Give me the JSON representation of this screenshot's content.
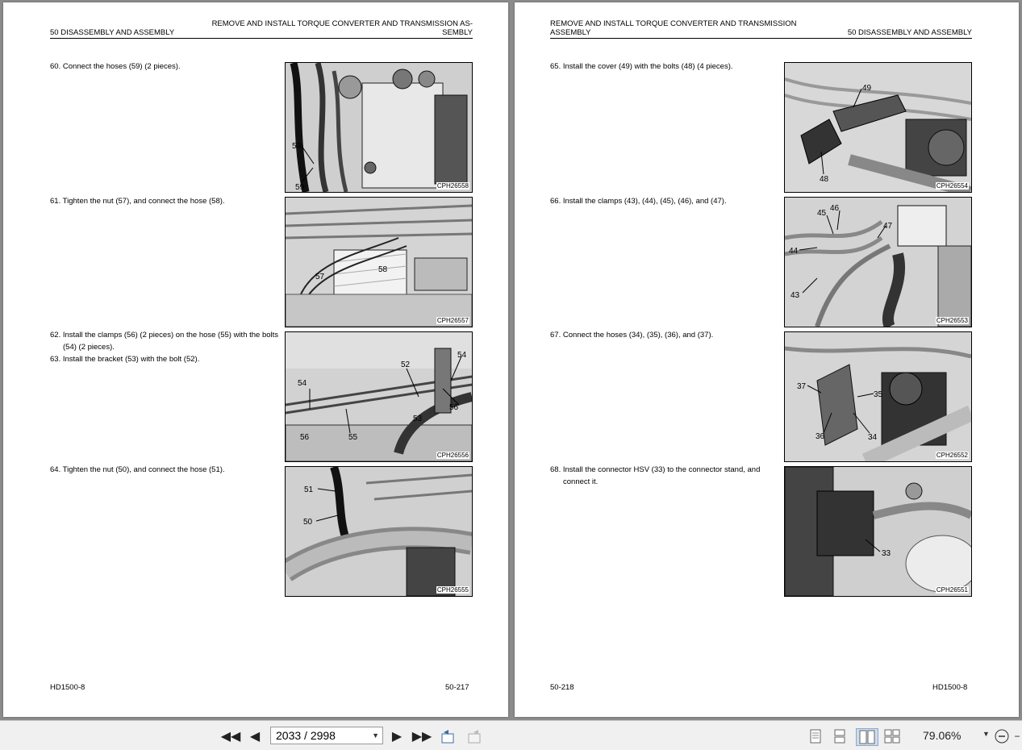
{
  "left_page": {
    "header_left": "50 DISASSEMBLY AND ASSEMBLY",
    "header_right": "REMOVE AND INSTALL TORQUE CONVERTER AND TRANSMISSION AS-SEMBLY",
    "steps": [
      {
        "text": "60. Connect the hoses (59) (2 pieces)."
      },
      {
        "text": "61. Tighten the nut (57), and connect the hose (58)."
      },
      {
        "text": "62. Install the clamps (56) (2 pieces) on the hose (55) with the bolts (54) (2 pieces).",
        "text2": "63. Install the bracket (53) with the bolt (52)."
      },
      {
        "text": "64. Tighten the nut (50), and connect the hose (51)."
      }
    ],
    "figures": [
      {
        "code": "CPH26558",
        "labels": [
          "59",
          "59"
        ]
      },
      {
        "code": "CPH26557",
        "labels": [
          "58",
          "57"
        ]
      },
      {
        "code": "CPH26556",
        "labels": [
          "52",
          "54",
          "54",
          "56",
          "53",
          "56",
          "55"
        ]
      },
      {
        "code": "CPH26555",
        "labels": [
          "51",
          "50"
        ]
      }
    ],
    "footer_left": "HD1500-8",
    "footer_right": "50-217"
  },
  "right_page": {
    "header_left": "REMOVE AND INSTALL TORQUE CONVERTER AND TRANSMISSION ASSEMBLY",
    "header_right": "50 DISASSEMBLY AND ASSEMBLY",
    "steps": [
      {
        "text": "65. Install the cover (49) with the bolts (48) (4 pieces)."
      },
      {
        "text": "66. Install the clamps (43), (44), (45), (46), and (47)."
      },
      {
        "text": "67. Connect the hoses (34), (35), (36), and (37)."
      },
      {
        "text": "68. Install the connector HSV (33) to the connector stand, and connect it."
      }
    ],
    "figures": [
      {
        "code": "CPH26554",
        "labels": [
          "49",
          "48"
        ]
      },
      {
        "code": "CPH26553",
        "labels": [
          "45",
          "46",
          "47",
          "44",
          "43"
        ]
      },
      {
        "code": "CPH26552",
        "labels": [
          "37",
          "35",
          "36",
          "34"
        ]
      },
      {
        "code": "CPH26551",
        "labels": [
          "33"
        ]
      }
    ],
    "footer_left": "50-218",
    "footer_right": "HD1500-8"
  },
  "toolbar": {
    "page_indicator": "2033 / 2998",
    "zoom": "79.06%",
    "icons": [
      "first-page-icon",
      "prev-page-icon",
      "next-page-icon",
      "last-page-icon",
      "previous-view-icon",
      "next-view-icon",
      "single-page-icon",
      "continuous-icon",
      "facing-icon",
      "continuous-facing-icon",
      "zoom-out-icon"
    ]
  }
}
